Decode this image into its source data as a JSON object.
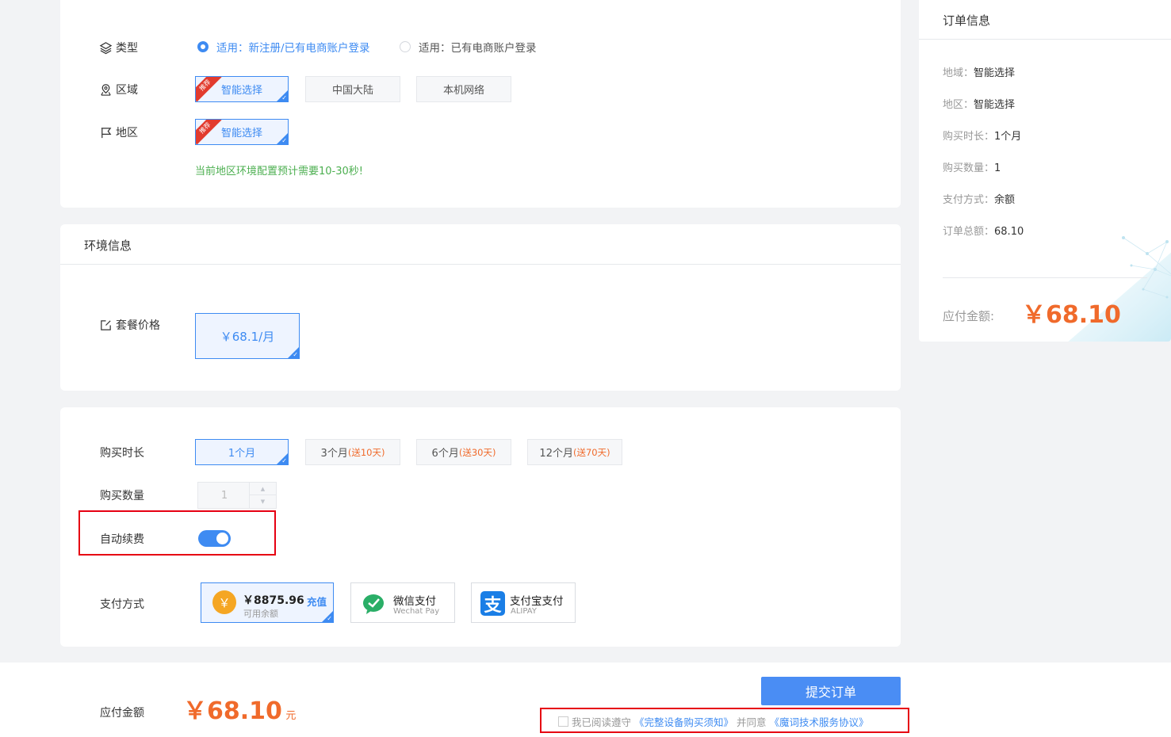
{
  "config": {
    "type_label": "类型",
    "type_options": [
      {
        "label": "适用：新注册/已有电商账户登录",
        "selected": true
      },
      {
        "label": "适用：已有电商账户登录",
        "selected": false
      }
    ],
    "zone_label": "区域",
    "zone_options": [
      {
        "label": "智能选择",
        "badge": "推荐",
        "selected": true
      },
      {
        "label": "中国大陆",
        "selected": false
      },
      {
        "label": "本机网络",
        "selected": false
      }
    ],
    "region_label": "地区",
    "region_options": [
      {
        "label": "智能选择",
        "badge": "推荐",
        "selected": true
      }
    ],
    "region_note": "当前地区环境配置预计需要10-30秒!"
  },
  "env": {
    "title": "环境信息",
    "package_label": "套餐价格",
    "package_price": "￥68.1/月"
  },
  "purchase": {
    "duration_label": "购买时长",
    "durations": [
      {
        "label": "1个月",
        "gift": "",
        "selected": true
      },
      {
        "label": "3个月",
        "gift": "(送10天)",
        "selected": false
      },
      {
        "label": "6个月",
        "gift": "(送30天)",
        "selected": false
      },
      {
        "label": "12个月",
        "gift": "(送70天)",
        "selected": false
      }
    ],
    "quantity_label": "购买数量",
    "quantity_value": "1",
    "auto_renew_label": "自动续费",
    "auto_renew_on": true,
    "payment_label": "支付方式",
    "balance": {
      "amount": "￥8875.96",
      "sub": "可用余额",
      "recharge": "充值",
      "symbol": "￥"
    },
    "wechat": {
      "name": "微信支付",
      "sub": "Wechat Pay"
    },
    "alipay": {
      "name": "支付宝支付",
      "sub": "ALIPAY",
      "glyph": "支"
    }
  },
  "order": {
    "title": "订单信息",
    "rows": [
      {
        "key": "地域：",
        "value": "智能选择"
      },
      {
        "key": "地区：",
        "value": "智能选择"
      },
      {
        "key": "购买时长：",
        "value": "1个月"
      },
      {
        "key": "购买数量：",
        "value": "1"
      },
      {
        "key": "支付方式：",
        "value": "余额"
      },
      {
        "key": "订单总额：",
        "value": "68.10"
      }
    ],
    "payable_label": "应付金额:",
    "payable_amount": "￥68.10"
  },
  "footer": {
    "payable_label": "应付金额",
    "amount": "￥68.10",
    "unit": "元",
    "submit_label": "提交订单",
    "agree_prefix": "我已阅读遵守",
    "agree_link1": "《完整设备购买须知》",
    "agree_mid": "并同意",
    "agree_link2": "《魔词技术服务协议》"
  },
  "colors": {
    "primary": "#3e8bf2",
    "accent_orange": "#f06a2b",
    "success_green": "#4caf50",
    "highlight_red": "#e60012"
  }
}
